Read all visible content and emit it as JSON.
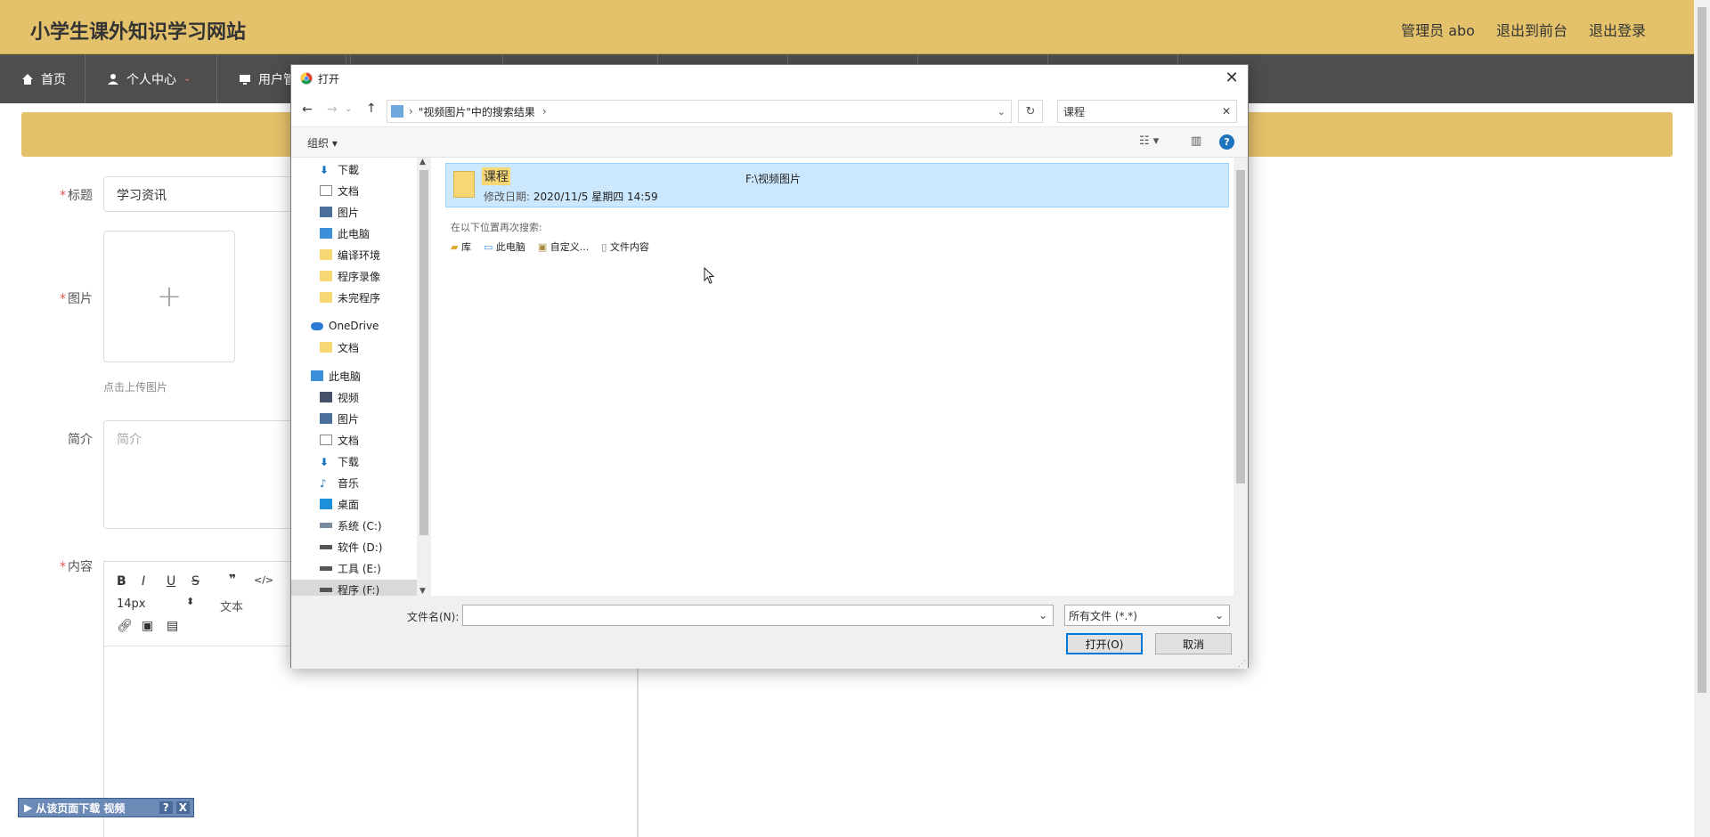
{
  "header": {
    "site_title": "小学生课外知识学习网站",
    "admin": "管理员 abo",
    "back_to_front": "退出到前台",
    "logout": "退出登录"
  },
  "nav": {
    "items": [
      {
        "label": "首页",
        "icon": "home-icon"
      },
      {
        "label": "个人中心",
        "icon": "user-icon"
      },
      {
        "label": "用户管",
        "icon": "monitor-icon"
      }
    ]
  },
  "form": {
    "title_label": "标题",
    "title_value": "学习资讯",
    "image_label": "图片",
    "upload_hint": "点击上传图片",
    "summary_label": "简介",
    "summary_placeholder": "简介",
    "content_label": "内容",
    "font_size": "14px",
    "text_style": "文本"
  },
  "extension_bar": {
    "label": "从该页面下载 视频",
    "help": "?",
    "close": "X"
  },
  "dialog": {
    "title": "打开",
    "address": "\"视频图片\"中的搜索结果",
    "search_value": "课程",
    "organize": "组织",
    "nav_pane": {
      "quick": [
        {
          "label": "下載",
          "icon": "download-icon"
        },
        {
          "label": "文档",
          "icon": "document-icon"
        },
        {
          "label": "图片",
          "icon": "picture-icon"
        },
        {
          "label": "此电脑",
          "icon": "computer-icon"
        },
        {
          "label": "编译环境",
          "icon": "folder-icon"
        },
        {
          "label": "程序录像",
          "icon": "folder-icon"
        },
        {
          "label": "未完程序",
          "icon": "folder-icon"
        }
      ],
      "onedrive": "OneDrive",
      "onedrive_children": [
        {
          "label": "文档",
          "icon": "folder-icon"
        }
      ],
      "this_pc": "此电脑",
      "pc_children": [
        {
          "label": "视频",
          "icon": "video-icon"
        },
        {
          "label": "图片",
          "icon": "picture-icon"
        },
        {
          "label": "文档",
          "icon": "document-icon"
        },
        {
          "label": "下载",
          "icon": "download-icon"
        },
        {
          "label": "音乐",
          "icon": "music-icon"
        },
        {
          "label": "桌面",
          "icon": "desktop-icon"
        },
        {
          "label": "系统 (C:)",
          "icon": "drive-icon"
        },
        {
          "label": "软件 (D:)",
          "icon": "drive-icon"
        },
        {
          "label": "工具 (E:)",
          "icon": "drive-icon"
        },
        {
          "label": "程序 (F:)",
          "icon": "drive-icon"
        }
      ]
    },
    "result": {
      "name": "课程",
      "modified_label": "修改日期:",
      "modified_value": "2020/11/5 星期四 14:59",
      "location": "F:\\视频图片"
    },
    "search_again_label": "在以下位置再次搜索:",
    "search_again": [
      "库",
      "此电脑",
      "自定义...",
      "文件内容"
    ],
    "filename_label": "文件名(N):",
    "filename_value": "",
    "filetype": "所有文件 (*.*)",
    "open_button": "打开(O)",
    "cancel_button": "取消"
  },
  "colors": {
    "header_bg": "#e4c26b",
    "nav_bg": "#4e4e4e",
    "selection_bg": "#cce8ff",
    "required": "#e4564f"
  }
}
